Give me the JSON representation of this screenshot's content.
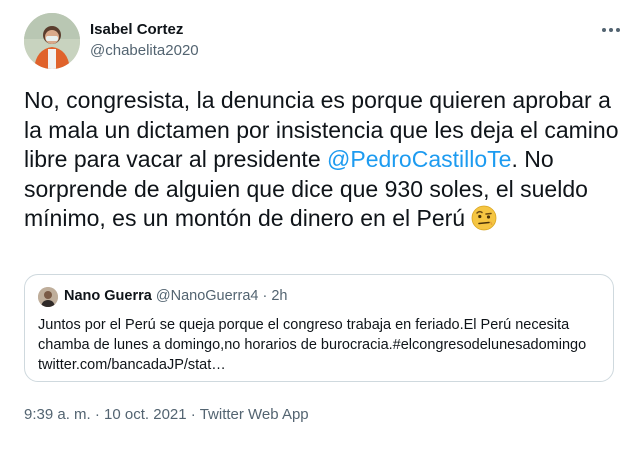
{
  "author": {
    "name": "Isabel Cortez",
    "handle": "@chabelita2020"
  },
  "tweet": {
    "text_before": "No, congresista, la denuncia es porque quieren aprobar a la mala un dictamen por insistencia que les deja el camino libre para vacar al presidente",
    "mention": "@PedroCastilloTe",
    "text_after": ". No sorprende de alguien que dice que 930 soles, el sueldo mínimo, es un montón de dinero en el Perú",
    "emoji_icon": "face-with-raised-eyebrow-emoji"
  },
  "quoted_tweet": {
    "name": "Nano Guerra",
    "handle": "@NanoGuerra4",
    "separator": "·",
    "time": "2h",
    "text": "Juntos por el Perú se queja porque el congreso trabaja en feriado.El Perú necesita chamba de lunes a domingo,no horarios de burocracia.#elcongresodelunesadomingo twitter.com/bancadaJP/stat…"
  },
  "meta": {
    "time": "9:39 a. m.",
    "separator": "·",
    "date": "10 oct. 2021",
    "app": "Twitter Web App"
  },
  "colors": {
    "link": "#1d9bf0",
    "secondary_text": "#536471",
    "border": "#cfd9de"
  }
}
